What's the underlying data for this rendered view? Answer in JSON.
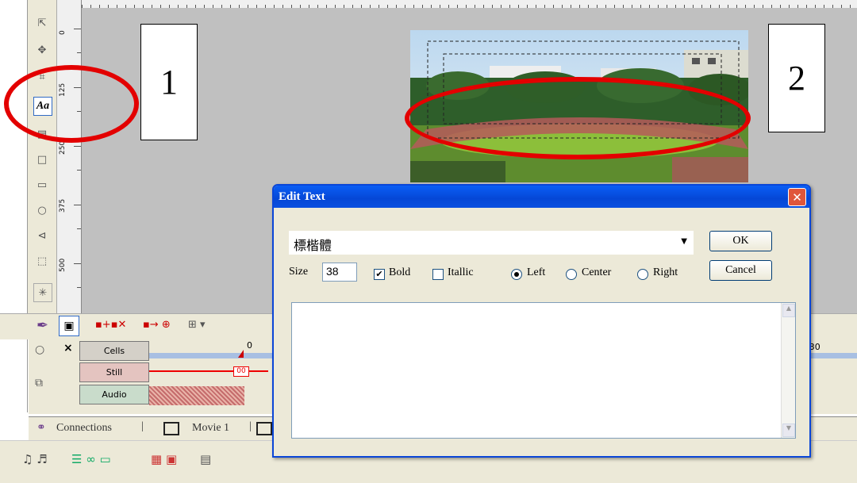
{
  "ruler": {
    "labels": [
      "0",
      "125",
      "250",
      "375",
      "500"
    ]
  },
  "annotations": {
    "box1": "1",
    "box2": "2"
  },
  "timeline": {
    "marker_zero": "0",
    "marker_30": ":30",
    "tracks": [
      "Cells",
      "Still",
      "Audio"
    ],
    "still_clip_tag": "00"
  },
  "tabs": {
    "connections": "Connections",
    "movie": "Movie 1"
  },
  "dialog": {
    "title": "Edit Text",
    "font_value": "標楷體",
    "ok": "OK",
    "cancel": "Cancel",
    "size_label": "Size",
    "size_value": "38",
    "bold": "Bold",
    "italic": "Itallic",
    "left": "Left",
    "center": "Center",
    "right": "Right",
    "bold_checked": true,
    "italic_checked": false,
    "alignment": "Left",
    "text": ""
  },
  "colors": {
    "annotation_red": "#e30000",
    "title_blue": "#0a46d8"
  },
  "icons": [
    "text-tool-icon",
    "rectangle-icon",
    "ellipse-icon",
    "polygon-icon",
    "close-icon",
    "dropdown-arrow-icon"
  ]
}
